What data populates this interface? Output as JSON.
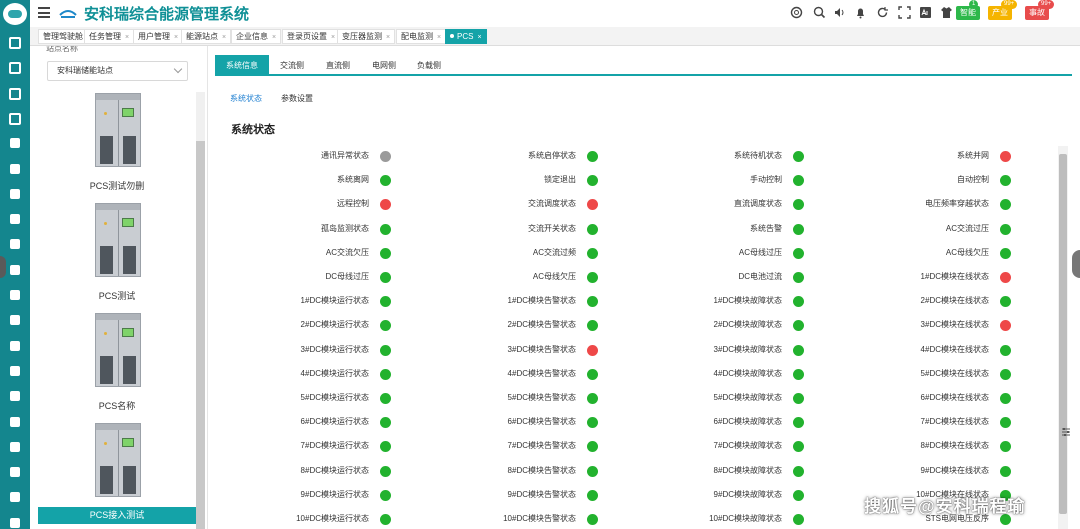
{
  "app": {
    "title": "安科瑞综合能源管理系统"
  },
  "header": {
    "buttons": [
      {
        "label": "智能",
        "color": "#2db84a",
        "badge": "1",
        "badge_color": "#2db84a"
      },
      {
        "label": "产业",
        "color": "#f5b400",
        "badge": "99+",
        "badge_color": "#f5b400"
      },
      {
        "label": "事故",
        "color": "#e84c4c",
        "badge": "99+",
        "badge_color": "#e84c4c"
      }
    ],
    "icons": [
      "help-icon",
      "search-icon",
      "volume-icon",
      "bell-icon",
      "refresh-icon",
      "fullscreen-icon",
      "font-size-icon",
      "theme-shirt-icon",
      "settings-icon"
    ]
  },
  "page_tabs": [
    {
      "label": "管理驾驶舱",
      "closable": false
    },
    {
      "label": "任务管理",
      "closable": true
    },
    {
      "label": "用户管理",
      "closable": true
    },
    {
      "label": "能源站点",
      "closable": true
    },
    {
      "label": "企业信息",
      "closable": true
    },
    {
      "label": "登录页设置",
      "closable": true
    },
    {
      "label": "变压器监测",
      "closable": true
    },
    {
      "label": "配电监测",
      "closable": true
    },
    {
      "label": "PCS",
      "closable": true,
      "active": true
    }
  ],
  "stations": {
    "field_label": "站点名称",
    "selected": "安科瑞储能站点",
    "items": [
      {
        "name": "PCS测试勿删",
        "active": false
      },
      {
        "name": "PCS测试",
        "active": false
      },
      {
        "name": "PCS名称",
        "active": false
      },
      {
        "name": "PCS接入测试",
        "active": true
      }
    ]
  },
  "subtabs": [
    "系统信息",
    "交流侧",
    "直流侧",
    "电网侧",
    "负载侧"
  ],
  "inner_tabs": [
    "系统状态",
    "参数设置"
  ],
  "section_title": "系统状态",
  "status_colors": {
    "green": "#22b22e",
    "red": "#ee4848",
    "gray": "#9a9a9a"
  },
  "status_rows": [
    [
      [
        "通讯异常状态",
        "gray"
      ],
      [
        "系统启停状态",
        "green"
      ],
      [
        "系统待机状态",
        "green"
      ],
      [
        "系统并网",
        "red"
      ]
    ],
    [
      [
        "系统离网",
        "green"
      ],
      [
        "锁定退出",
        "green"
      ],
      [
        "手动控制",
        "green"
      ],
      [
        "自动控制",
        "green"
      ]
    ],
    [
      [
        "远程控制",
        "red"
      ],
      [
        "交流调度状态",
        "red"
      ],
      [
        "直流调度状态",
        "green"
      ],
      [
        "电压频率穿越状态",
        "green"
      ]
    ],
    [
      [
        "孤岛监测状态",
        "green"
      ],
      [
        "交流开关状态",
        "green"
      ],
      [
        "系统告警",
        "green"
      ],
      [
        "AC交流过压",
        "green"
      ]
    ],
    [
      [
        "AC交流欠压",
        "green"
      ],
      [
        "AC交流过频",
        "green"
      ],
      [
        "AC母线过压",
        "green"
      ],
      [
        "AC母线欠压",
        "green"
      ]
    ],
    [
      [
        "DC母线过压",
        "green"
      ],
      [
        "AC母线欠压",
        "green"
      ],
      [
        "DC电池过流",
        "green"
      ],
      [
        "1#DC模块在线状态",
        "red"
      ]
    ],
    [
      [
        "1#DC模块运行状态",
        "green"
      ],
      [
        "1#DC模块告警状态",
        "green"
      ],
      [
        "1#DC模块故障状态",
        "green"
      ],
      [
        "2#DC模块在线状态",
        "green"
      ]
    ],
    [
      [
        "2#DC模块运行状态",
        "green"
      ],
      [
        "2#DC模块告警状态",
        "green"
      ],
      [
        "2#DC模块故障状态",
        "green"
      ],
      [
        "3#DC模块在线状态",
        "red"
      ]
    ],
    [
      [
        "3#DC模块运行状态",
        "green"
      ],
      [
        "3#DC模块告警状态",
        "red"
      ],
      [
        "3#DC模块故障状态",
        "green"
      ],
      [
        "4#DC模块在线状态",
        "green"
      ]
    ],
    [
      [
        "4#DC模块运行状态",
        "green"
      ],
      [
        "4#DC模块告警状态",
        "green"
      ],
      [
        "4#DC模块故障状态",
        "green"
      ],
      [
        "5#DC模块在线状态",
        "green"
      ]
    ],
    [
      [
        "5#DC模块运行状态",
        "green"
      ],
      [
        "5#DC模块告警状态",
        "green"
      ],
      [
        "5#DC模块故障状态",
        "green"
      ],
      [
        "6#DC模块在线状态",
        "green"
      ]
    ],
    [
      [
        "6#DC模块运行状态",
        "green"
      ],
      [
        "6#DC模块告警状态",
        "green"
      ],
      [
        "6#DC模块故障状态",
        "green"
      ],
      [
        "7#DC模块在线状态",
        "green"
      ]
    ],
    [
      [
        "7#DC模块运行状态",
        "green"
      ],
      [
        "7#DC模块告警状态",
        "green"
      ],
      [
        "7#DC模块故障状态",
        "green"
      ],
      [
        "8#DC模块在线状态",
        "green"
      ]
    ],
    [
      [
        "8#DC模块运行状态",
        "green"
      ],
      [
        "8#DC模块告警状态",
        "green"
      ],
      [
        "8#DC模块故障状态",
        "green"
      ],
      [
        "9#DC模块在线状态",
        "green"
      ]
    ],
    [
      [
        "9#DC模块运行状态",
        "green"
      ],
      [
        "9#DC模块告警状态",
        "green"
      ],
      [
        "9#DC模块故障状态",
        "green"
      ],
      [
        "10#DC模块在线状态",
        "green"
      ]
    ],
    [
      [
        "10#DC模块运行状态",
        "green"
      ],
      [
        "10#DC模块告警状态",
        "green"
      ],
      [
        "10#DC模块故障状态",
        "green"
      ],
      [
        "STS电网电压反序",
        "green"
      ]
    ]
  ],
  "watermark": "搜狐号@安科瑞程瑜"
}
